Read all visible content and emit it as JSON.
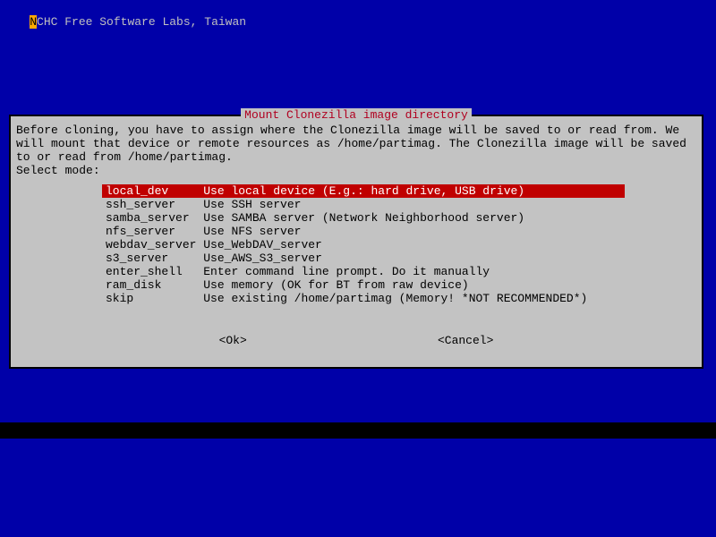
{
  "header": {
    "mark": "N",
    "text": "CHC Free Software Labs, Taiwan"
  },
  "dialog": {
    "title": "Mount Clonezilla image directory",
    "desc_line1": "Before cloning, you have to assign where the Clonezilla image will be saved to or read from. We",
    "desc_line2": "will mount that device or remote resources as /home/partimag. The Clonezilla image will be saved",
    "desc_line3": "to or read from /home/partimag.",
    "desc_line4": "Select mode:"
  },
  "menu": {
    "items": [
      {
        "key": "local_dev",
        "pad": "    ",
        "label": "Use local device (E.g.: hard drive, USB drive)",
        "selected": true
      },
      {
        "key": "ssh_server",
        "pad": "   ",
        "label": "Use SSH server",
        "selected": false
      },
      {
        "key": "samba_server",
        "pad": " ",
        "label": "Use SAMBA server (Network Neighborhood server)",
        "selected": false
      },
      {
        "key": "nfs_server",
        "pad": "   ",
        "label": "Use NFS server",
        "selected": false
      },
      {
        "key": "webdav_server",
        "pad": "",
        "label": "Use_WebDAV_server",
        "selected": false
      },
      {
        "key": "s3_server",
        "pad": "    ",
        "label": "Use_AWS_S3_server",
        "selected": false
      },
      {
        "key": "enter_shell",
        "pad": "  ",
        "label": "Enter command line prompt. Do it manually",
        "selected": false
      },
      {
        "key": "ram_disk",
        "pad": "     ",
        "label": "Use memory (OK for BT from raw device)",
        "selected": false
      },
      {
        "key": "skip",
        "pad": "         ",
        "label": "Use existing /home/partimag (Memory! *NOT RECOMMENDED*)",
        "selected": false
      }
    ]
  },
  "buttons": {
    "ok": "<Ok>",
    "cancel": "<Cancel>"
  }
}
